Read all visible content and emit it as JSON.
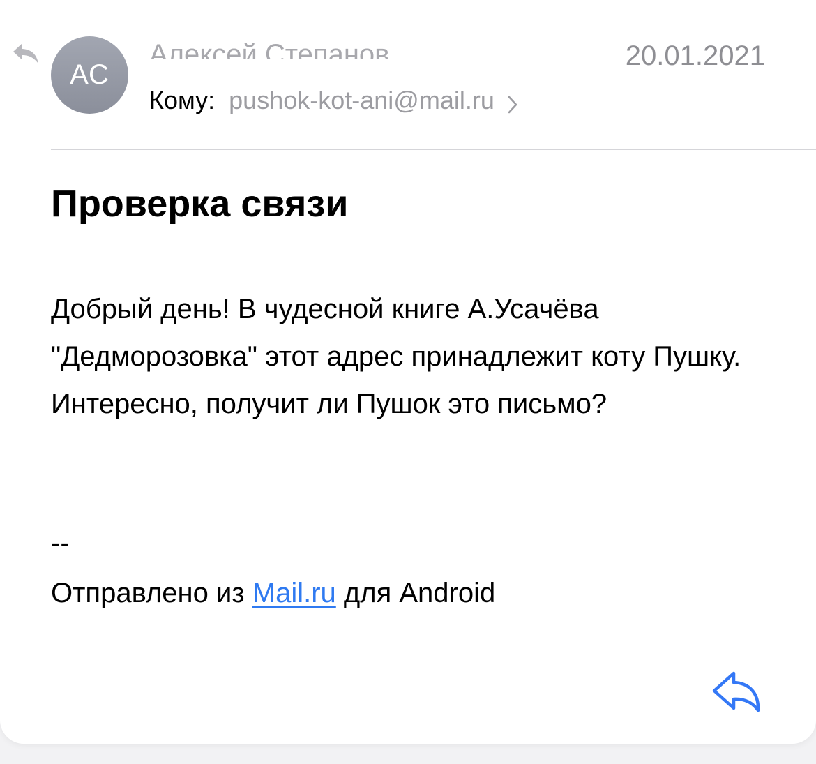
{
  "header": {
    "avatar_initials": "АС",
    "sender_name": "Алексей Степанов",
    "date": "20.01.2021",
    "to_label": "Кому:",
    "to_address": "pushok-kot-ani@mail.ru"
  },
  "message": {
    "subject": "Проверка связи",
    "body": "Добрый день! В чудесной книге А.Усачёва \"Дедморозовка\" этот адрес принадлежит коту Пушку. Интересно, получит ли Пушок это письмо?",
    "signature_separator": "--",
    "signature_prefix": "Отправлено из ",
    "signature_link": "Mail.ru",
    "signature_suffix": " для Android"
  },
  "icons": {
    "replied_indicator": "reply-arrow-icon",
    "to_chevron": "chevron-right-icon",
    "reply_button": "reply-arrow-icon"
  },
  "colors": {
    "link": "#2f7af1",
    "reply_button": "#3478f6",
    "avatar": "#989ca8",
    "secondary_text": "#9c9ca1"
  }
}
